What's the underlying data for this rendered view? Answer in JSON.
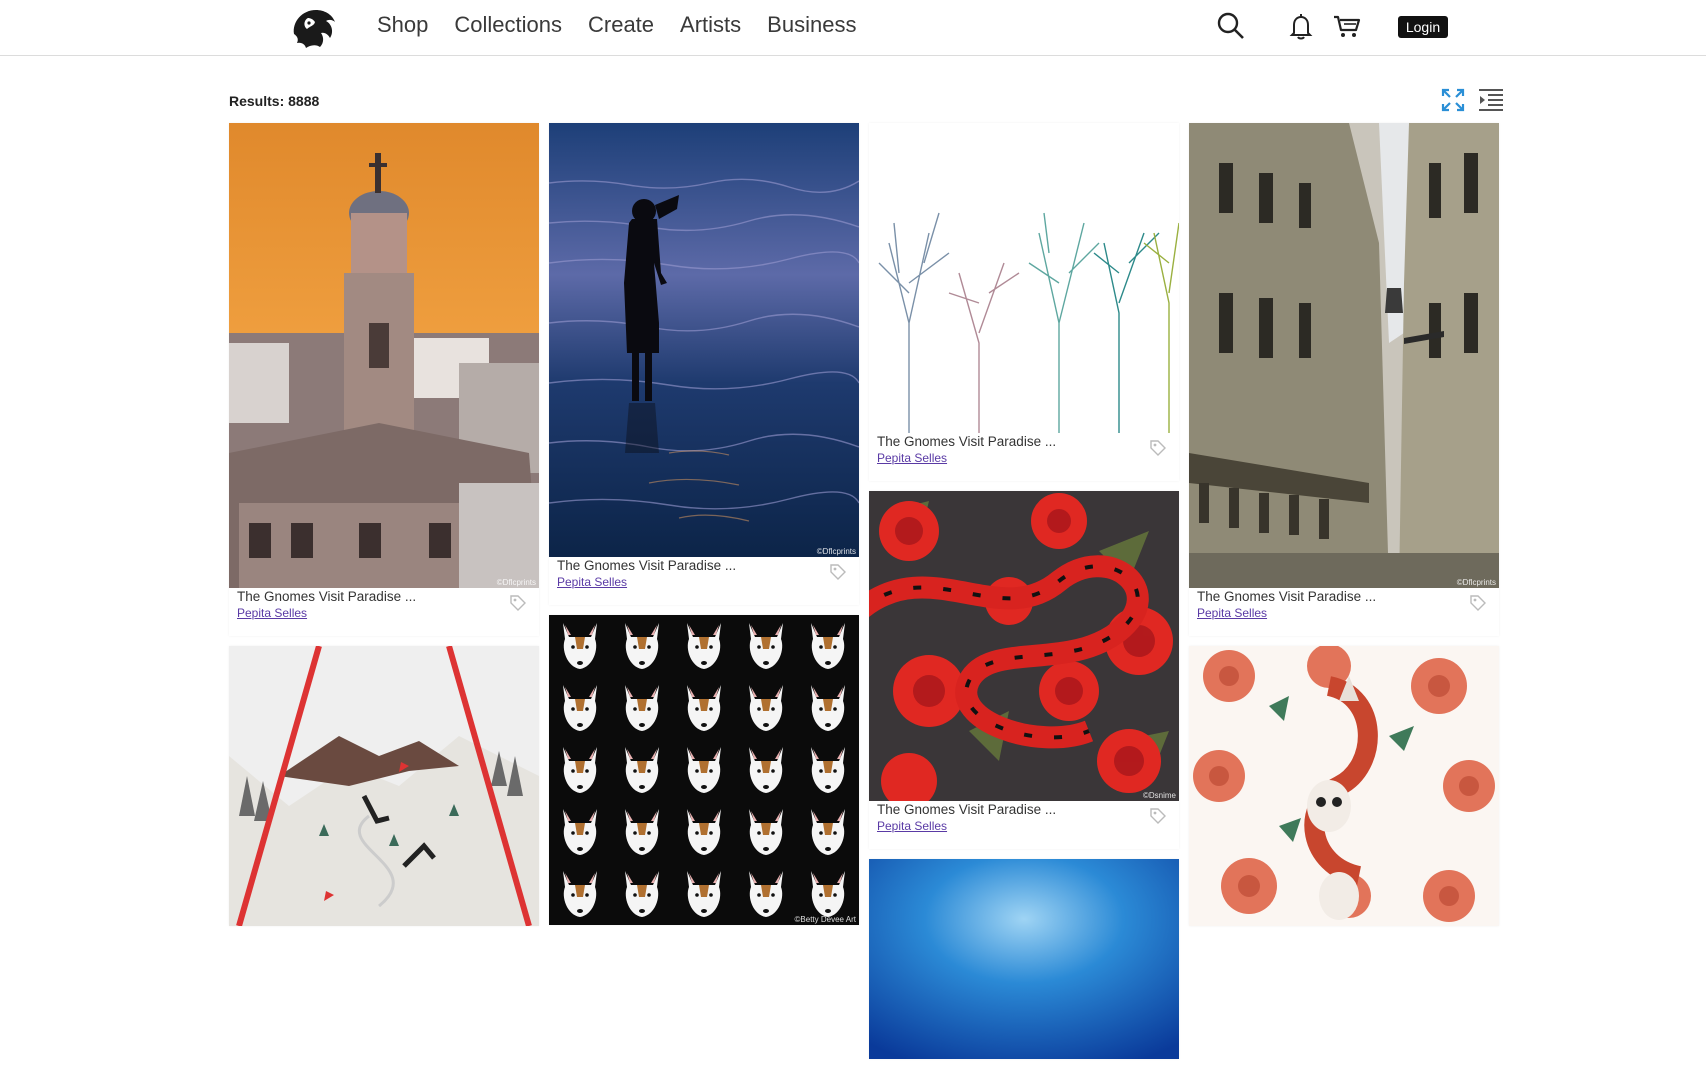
{
  "nav": {
    "items": [
      {
        "label": "Shop"
      },
      {
        "label": "Collections"
      },
      {
        "label": "Create"
      },
      {
        "label": "Artists"
      },
      {
        "label": "Business"
      }
    ],
    "login_label": "Login"
  },
  "results": {
    "label": "Results: 8888"
  },
  "cards": [
    {
      "title": "The Gnomes Visit Paradise ...",
      "artist": "Pepita Selles",
      "watermark": "©Dflcprints",
      "image": "church-tower-sunset"
    },
    {
      "title": "The Gnomes Visit Paradise ...",
      "artist": "Pepita Selles",
      "watermark": "©Dflcprints",
      "image": "silhouette-in-water"
    },
    {
      "title": "The Gnomes Visit Paradise ...",
      "artist": "Pepita Selles",
      "image": "colorful-bare-trees"
    },
    {
      "title": "The Gnomes Visit Paradise ...",
      "artist": "Pepita Selles",
      "watermark": "©Dflcprints",
      "image": "narrow-street-buildings"
    },
    {
      "title": "The Gnomes Visit Paradise ...",
      "artist": "Pepita Selles",
      "watermark": "©Dsnime",
      "image": "snake-and-roses-pattern"
    },
    {
      "image": "ski-slope-illustration"
    },
    {
      "watermark": "©Betty Devee Art",
      "image": "bull-terrier-pattern"
    },
    {
      "image": "snake-skulls-roses"
    },
    {
      "image": "blue-sky"
    }
  ],
  "colors": {
    "accent": "#2a8fd6",
    "artist_link": "#5a3aa5",
    "login_bg": "#111111"
  }
}
